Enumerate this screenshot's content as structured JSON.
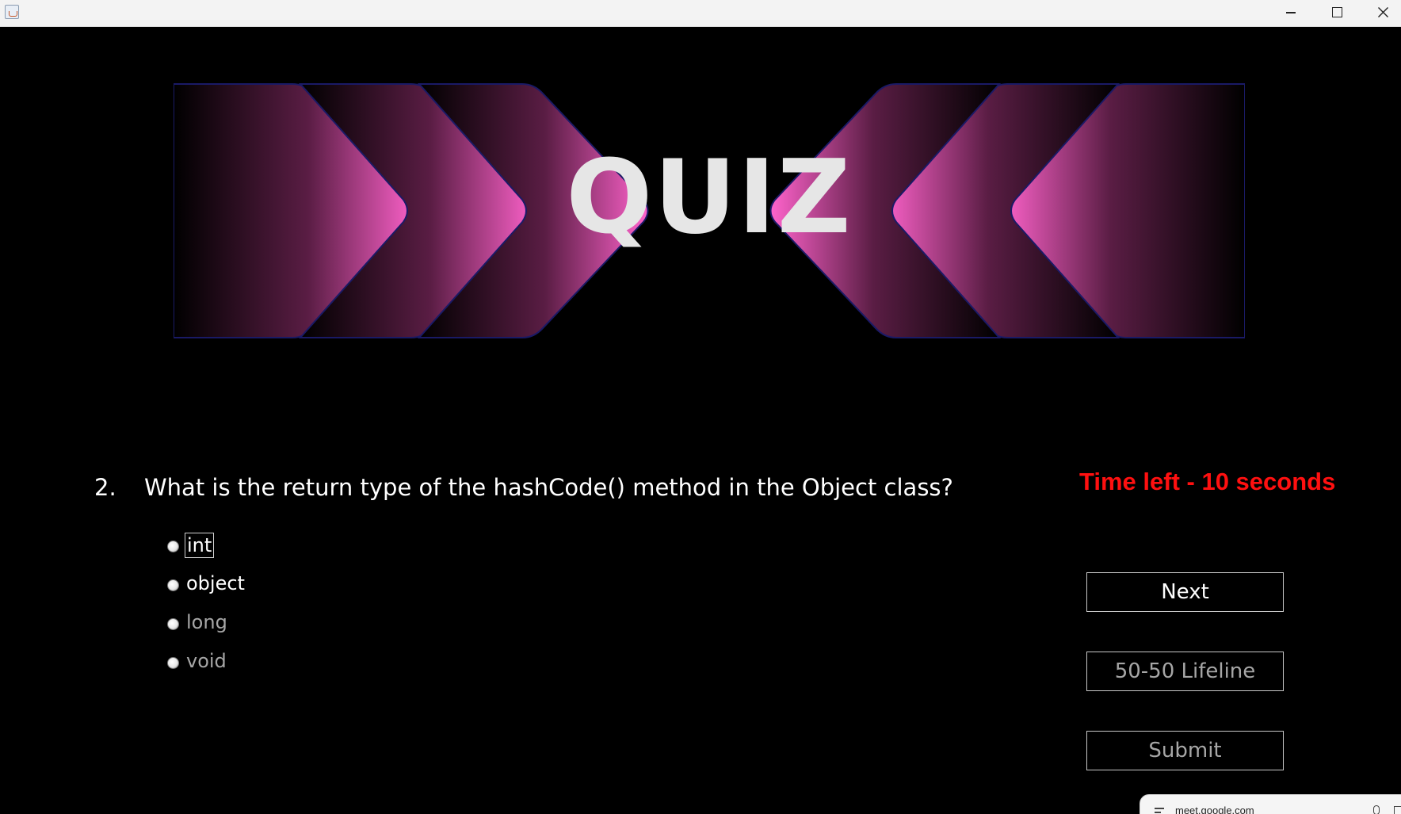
{
  "window": {
    "app_icon": "java-cup-icon",
    "controls": [
      "minimize",
      "maximize",
      "close"
    ]
  },
  "banner": {
    "title": "QUIZ",
    "colors": {
      "accent": "#ff5fc8",
      "text": "#e6e6e6"
    }
  },
  "question": {
    "number": "2.",
    "text": "What is the return type of the hashCode() method in the Object class?"
  },
  "timer": {
    "text": "Time left - 10 seconds",
    "color": "#ff1010"
  },
  "options": [
    {
      "label": "int",
      "enabled": true
    },
    {
      "label": "object",
      "enabled": true
    },
    {
      "label": "long",
      "enabled": false
    },
    {
      "label": "void",
      "enabled": false
    }
  ],
  "buttons": {
    "next": "Next",
    "lifeline": "50-50 Lifeline",
    "submit": "Submit"
  },
  "share_bar": {
    "url": "meet.google.com"
  }
}
